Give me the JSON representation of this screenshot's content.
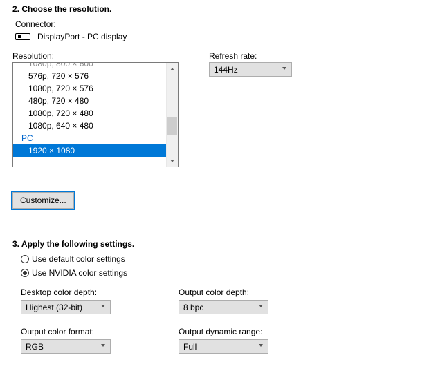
{
  "section2": {
    "title": "2. Choose the resolution.",
    "connector_label": "Connector:",
    "connector_value": "DisplayPort - PC display",
    "resolution_label": "Resolution:",
    "refresh_label": "Refresh rate:",
    "refresh_value": "144Hz",
    "customize_label": "Customize...",
    "resolutions": {
      "partial_top": "1080p, 800 × 600",
      "items": [
        "576p, 720 × 576",
        "1080p, 720 × 576",
        "480p, 720 × 480",
        "1080p, 720 × 480",
        "1080p, 640 × 480"
      ],
      "group_label": "PC",
      "selected": "1920 × 1080"
    }
  },
  "section3": {
    "title": "3. Apply the following settings.",
    "radio_default": "Use default color settings",
    "radio_nvidia": "Use NVIDIA color settings",
    "desktop_depth_label": "Desktop color depth:",
    "desktop_depth_value": "Highest (32-bit)",
    "output_depth_label": "Output color depth:",
    "output_depth_value": "8 bpc",
    "output_format_label": "Output color format:",
    "output_format_value": "RGB",
    "output_range_label": "Output dynamic range:",
    "output_range_value": "Full"
  }
}
